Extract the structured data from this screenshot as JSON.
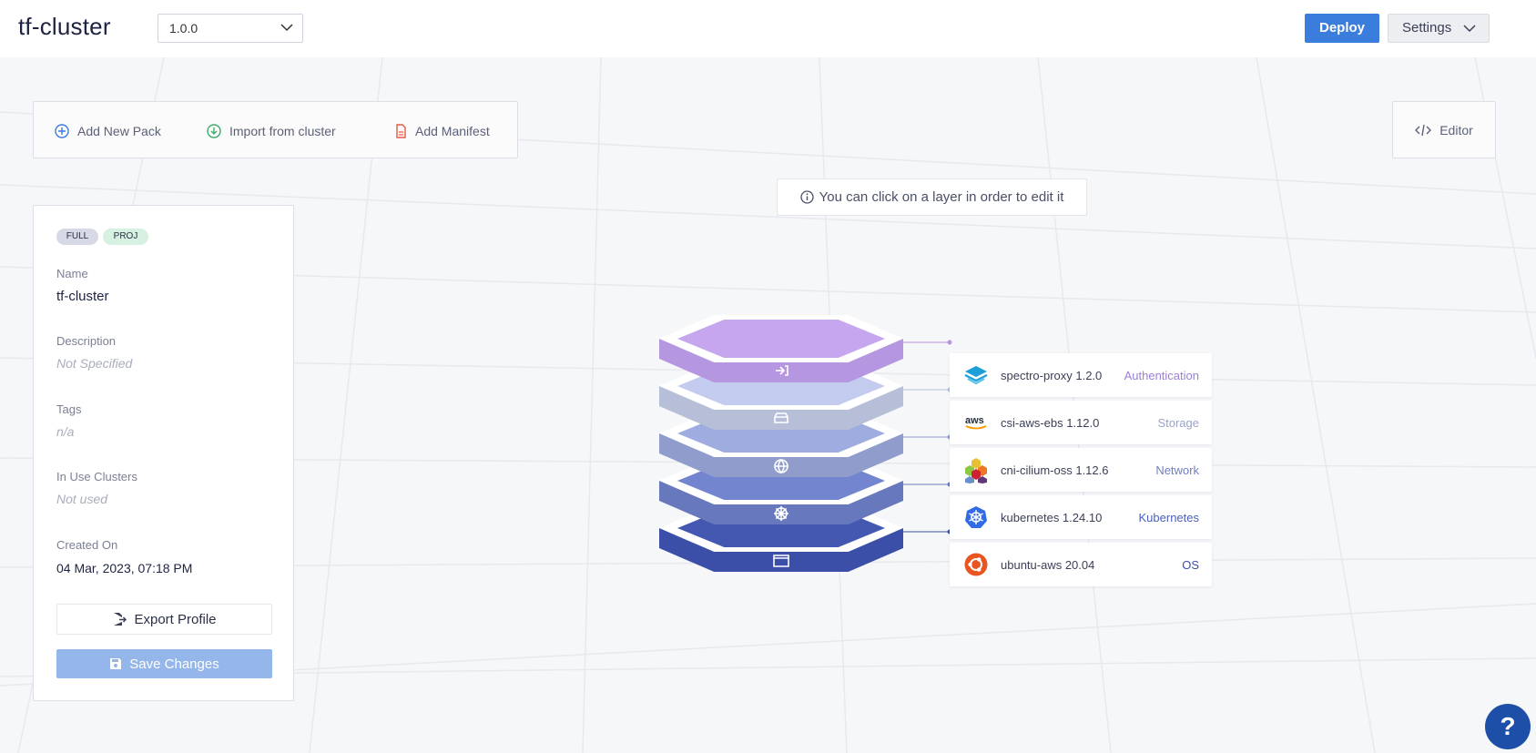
{
  "header": {
    "title": "tf-cluster",
    "version": "1.0.0",
    "deploy_label": "Deploy",
    "settings_label": "Settings"
  },
  "toolbar": {
    "add_pack": "Add New Pack",
    "import_cluster": "Import from cluster",
    "add_manifest": "Add Manifest",
    "editor": "Editor"
  },
  "hint": "You can click on a layer in order to edit it",
  "profile": {
    "badges": [
      "FULL",
      "PROJ"
    ],
    "name_label": "Name",
    "name": "tf-cluster",
    "description_label": "Description",
    "description": "Not Specified",
    "tags_label": "Tags",
    "tags": "n/a",
    "clusters_label": "In Use Clusters",
    "clusters": "Not used",
    "created_label": "Created On",
    "created": "04 Mar, 2023, 07:18 PM",
    "export_label": "Export Profile",
    "save_label": "Save Changes"
  },
  "layers": [
    {
      "pack": "spectro-proxy 1.2.0",
      "category": "Authentication",
      "color": "#c5a6ef",
      "side": "#b596e0",
      "icon": "login-icon",
      "logo": "spectro-logo",
      "cat_color": "#9b7fd6"
    },
    {
      "pack": "csi-aws-ebs 1.12.0",
      "category": "Storage",
      "color": "#c3cbef",
      "side": "#b7bfd8",
      "icon": "drive-icon",
      "logo": "aws-logo",
      "cat_color": "#9aa3c7"
    },
    {
      "pack": "cni-cilium-oss 1.12.6",
      "category": "Network",
      "color": "#9eacdf",
      "side": "#8f9ccc",
      "icon": "globe-icon",
      "logo": "cilium-logo",
      "cat_color": "#6f7fc2"
    },
    {
      "pack": "kubernetes 1.24.10",
      "category": "Kubernetes",
      "color": "#7385cf",
      "side": "#6878bd",
      "icon": "helm-icon",
      "logo": "kubernetes-logo",
      "cat_color": "#4a5fc0"
    },
    {
      "pack": "ubuntu-aws 20.04",
      "category": "OS",
      "color": "#4458b2",
      "side": "#3b4fa8",
      "icon": "window-icon",
      "logo": "ubuntu-logo",
      "cat_color": "#3b4fa8"
    }
  ],
  "help_label": "?"
}
